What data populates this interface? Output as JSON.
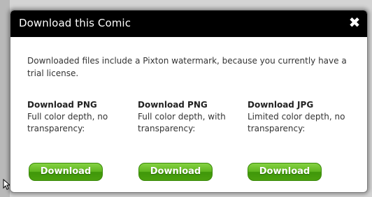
{
  "dialog": {
    "title": "Download this Comic",
    "close_glyph": "✖",
    "message": "Downloaded files include a Pixton watermark, because you currently have a trial license.",
    "options": [
      {
        "title": "Download PNG",
        "description": "Full color depth, no transparency:",
        "button_label": "Download"
      },
      {
        "title": "Download PNG",
        "description": "Full color depth, with transparency:",
        "button_label": "Download"
      },
      {
        "title": "Download JPG",
        "description": "Limited color depth, no transparency:",
        "button_label": "Download"
      }
    ]
  },
  "colors": {
    "titlebar_bg": "#000000",
    "button_green": "#4aa00f",
    "text": "#333333"
  },
  "icons": {
    "close": "close-icon",
    "cursor": "mouse-cursor-icon"
  }
}
